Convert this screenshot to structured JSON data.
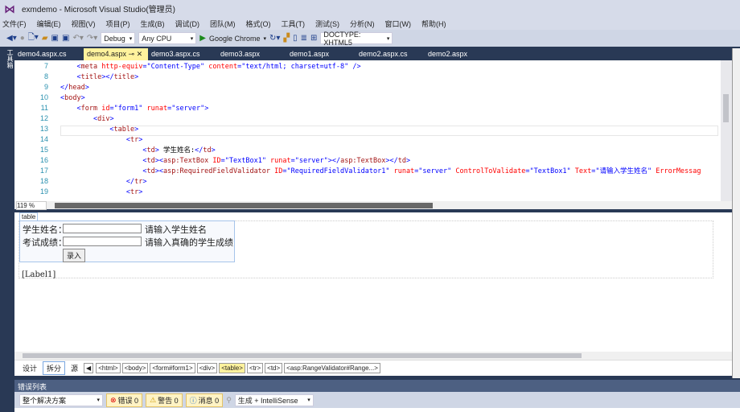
{
  "window": {
    "title": "exmdemo - Microsoft Visual Studio(管理员)"
  },
  "menu": [
    "文件(F)",
    "编辑(E)",
    "视图(V)",
    "项目(P)",
    "生成(B)",
    "调试(D)",
    "团队(M)",
    "格式(O)",
    "工具(T)",
    "测试(S)",
    "分析(N)",
    "窗口(W)",
    "帮助(H)"
  ],
  "toolbar": {
    "config": "Debug",
    "platform": "Any CPU",
    "browser": "Google Chrome",
    "doctype": "DOCTYPE: XHTML5"
  },
  "toolbox_label": "工具箱",
  "tabs": [
    "demo4.aspx.cs",
    "demo4.aspx",
    "demo3.aspx.cs",
    "demo3.aspx",
    "demo1.aspx",
    "demo2.aspx.cs",
    "demo2.aspx"
  ],
  "code": {
    "line_numbers": [
      "7",
      "8",
      "9",
      "10",
      "11",
      "12",
      "13",
      "14",
      "15",
      "16",
      "17",
      "18",
      "19"
    ],
    "lines": [
      [
        [
          "t",
          "    "
        ],
        [
          "d",
          "<"
        ],
        [
          "n",
          "meta"
        ],
        [
          "a",
          " http-equiv"
        ],
        [
          "d",
          "=\"Content-Type\""
        ],
        [
          "a",
          " content"
        ],
        [
          "d",
          "=\"text/html; charset=utf-8\""
        ],
        [
          "d",
          " />"
        ]
      ],
      [
        [
          "t",
          "    "
        ],
        [
          "d",
          "<"
        ],
        [
          "n",
          "title"
        ],
        [
          "d",
          "></"
        ],
        [
          "n",
          "title"
        ],
        [
          "d",
          ">"
        ]
      ],
      [
        [
          "d",
          "</"
        ],
        [
          "n",
          "head"
        ],
        [
          "d",
          ">"
        ]
      ],
      [
        [
          "d",
          "<"
        ],
        [
          "n",
          "body"
        ],
        [
          "d",
          ">"
        ]
      ],
      [
        [
          "t",
          "    "
        ],
        [
          "d",
          "<"
        ],
        [
          "n",
          "form"
        ],
        [
          "a",
          " id"
        ],
        [
          "d",
          "=\"form1\""
        ],
        [
          "a",
          " runat"
        ],
        [
          "d",
          "=\"server\""
        ],
        [
          "d",
          ">"
        ]
      ],
      [
        [
          "t",
          "        "
        ],
        [
          "d",
          "<"
        ],
        [
          "n",
          "div"
        ],
        [
          "d",
          ">"
        ]
      ],
      [
        [
          "t",
          "            "
        ],
        [
          "d",
          "<"
        ],
        [
          "n",
          "table"
        ],
        [
          "d",
          ">"
        ]
      ],
      [
        [
          "t",
          "                "
        ],
        [
          "d",
          "<"
        ],
        [
          "n",
          "tr"
        ],
        [
          "d",
          ">"
        ]
      ],
      [
        [
          "t",
          "                    "
        ],
        [
          "d",
          "<"
        ],
        [
          "n",
          "td"
        ],
        [
          "d",
          ">"
        ],
        [
          "t",
          " 学生姓名:"
        ],
        [
          "d",
          "</"
        ],
        [
          "n",
          "td"
        ],
        [
          "d",
          ">"
        ]
      ],
      [
        [
          "t",
          "                    "
        ],
        [
          "d",
          "<"
        ],
        [
          "n",
          "td"
        ],
        [
          "d",
          "><"
        ],
        [
          "n",
          "asp:TextBox"
        ],
        [
          "a",
          " ID"
        ],
        [
          "d",
          "=\"TextBox1\""
        ],
        [
          "a",
          " runat"
        ],
        [
          "d",
          "=\"server\""
        ],
        [
          "d",
          "></"
        ],
        [
          "n",
          "asp:TextBox"
        ],
        [
          "d",
          "></"
        ],
        [
          "n",
          "td"
        ],
        [
          "d",
          ">"
        ]
      ],
      [
        [
          "t",
          "                    "
        ],
        [
          "d",
          "<"
        ],
        [
          "n",
          "td"
        ],
        [
          "d",
          "><"
        ],
        [
          "n",
          "asp:RequiredFieldValidator"
        ],
        [
          "a",
          " ID"
        ],
        [
          "d",
          "=\"RequiredFieldValidator1\""
        ],
        [
          "a",
          " runat"
        ],
        [
          "d",
          "=\"server\""
        ],
        [
          "a",
          " ControlToValidate"
        ],
        [
          "d",
          "=\"TextBox1\""
        ],
        [
          "a",
          " Text"
        ],
        [
          "d",
          "=\"请输入学生姓名\""
        ],
        [
          "a",
          " ErrorMessag"
        ]
      ],
      [
        [
          "t",
          "                "
        ],
        [
          "d",
          "</"
        ],
        [
          "n",
          "tr"
        ],
        [
          "d",
          ">"
        ]
      ],
      [
        [
          "t",
          "                "
        ],
        [
          "d",
          "<"
        ],
        [
          "n",
          "tr"
        ],
        [
          "d",
          ">"
        ]
      ]
    ]
  },
  "zoom": "119 %",
  "design": {
    "tag_label": "table",
    "row1_label": "学生姓名：",
    "row1_msg": "请输入学生姓名",
    "row2_label": "考试成绩：",
    "row2_msg": "请输入真确的学生成绩",
    "submit": "录入",
    "label": "[Label1]"
  },
  "views": {
    "design": "设计",
    "split": "拆分",
    "source": "源"
  },
  "breadcrumbs": [
    "<html>",
    "<body>",
    "<form#form1>",
    "<div>",
    "<table>",
    "<tr>",
    "<td>",
    "<asp:RangeValidator#Range...>"
  ],
  "errors": {
    "title": "错误列表",
    "scope": "整个解决方案",
    "errors": "错误 0",
    "warnings": "警告 0",
    "messages": "消息 0",
    "source": "生成 + IntelliSense"
  }
}
